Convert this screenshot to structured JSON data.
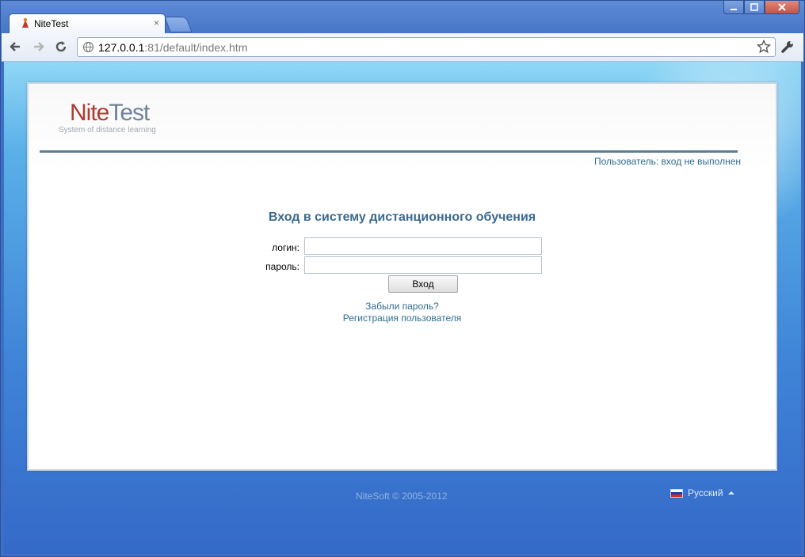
{
  "browser": {
    "tab_title": "NiteTest",
    "tab_close": "×",
    "url_host": "127.0.0.1",
    "url_rest": ":81/default/index.htm",
    "icons": {
      "back": "back-arrow-icon",
      "forward": "forward-arrow-icon",
      "reload": "reload-icon",
      "globe": "globe-icon",
      "star": "bookmark-star-icon",
      "wrench": "wrench-menu-icon"
    }
  },
  "header": {
    "logo_nite": "Nite",
    "logo_test": "Test",
    "logo_subtitle": "System of distance learning",
    "user_status": "Пользователь: вход не выполнен"
  },
  "login": {
    "title": "Вход в систему дистанционного обучения",
    "login_label": "логин:",
    "login_value": "",
    "password_label": "пароль:",
    "password_value": "",
    "submit_label": "Вход",
    "forgot_link": "Забыли пароль?",
    "register_link": "Регистрация пользователя"
  },
  "footer": {
    "copyright": "NiteSoft © 2005-2012",
    "language": "Русский"
  },
  "colors": {
    "accent": "#3a6a8e",
    "link": "#2f6d8f",
    "logo_red": "#b23a32",
    "logo_gray": "#6f8299"
  }
}
